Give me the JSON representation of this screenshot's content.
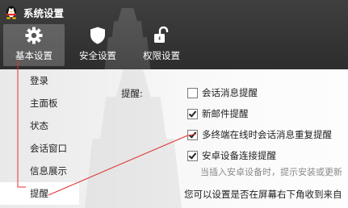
{
  "window": {
    "title": "系统设置"
  },
  "tabs": [
    {
      "label": "基本设置",
      "icon": "gear-icon",
      "active": true
    },
    {
      "label": "安全设置",
      "icon": "shield-icon",
      "active": false
    },
    {
      "label": "权限设置",
      "icon": "unlock-icon",
      "active": false
    }
  ],
  "sidebar": {
    "items": [
      {
        "label": "登录"
      },
      {
        "label": "主面板"
      },
      {
        "label": "状态"
      },
      {
        "label": "会话窗口"
      },
      {
        "label": "信息展示"
      },
      {
        "label": "提醒",
        "active": true
      }
    ]
  },
  "settings": {
    "group_label": "提醒:",
    "options": [
      {
        "label": "会话消息提醒",
        "checked": false
      },
      {
        "label": "新邮件提醒",
        "checked": true
      },
      {
        "label": "多终端在线时会话消息重复提醒",
        "checked": true
      },
      {
        "label": "安卓设备连接提醒",
        "checked": true
      }
    ],
    "android_hint": "当插入安卓设备时，提示安装或更新",
    "notice": "您可以设置是否在屏幕右下角收到来自"
  },
  "colors": {
    "header": "#333333",
    "annotation_line": "#e03030"
  }
}
